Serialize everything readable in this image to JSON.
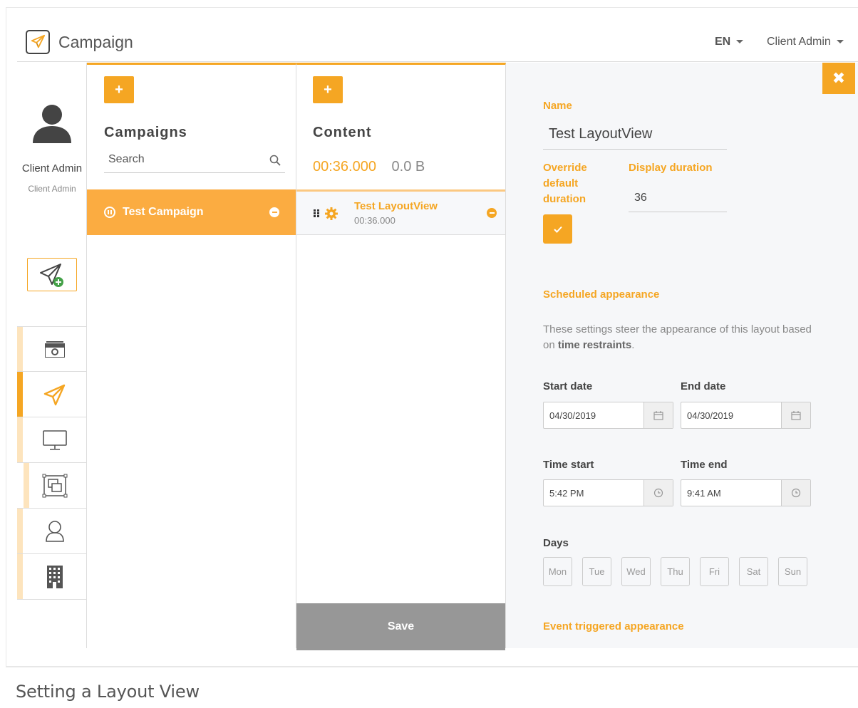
{
  "app": {
    "title": "Campaign"
  },
  "header": {
    "lang": "EN",
    "user_menu": "Client Admin"
  },
  "sidebar": {
    "user_name": "Client Admin",
    "user_role": "Client Admin",
    "nav": [
      {
        "name": "nav-media",
        "icon": "camera-icon"
      },
      {
        "name": "nav-campaigns",
        "icon": "paper-plane-icon",
        "active": true
      },
      {
        "name": "nav-screens",
        "icon": "monitor-icon"
      },
      {
        "name": "nav-layouts",
        "icon": "layout-icon"
      },
      {
        "name": "nav-users",
        "icon": "user-icon"
      },
      {
        "name": "nav-buildings",
        "icon": "building-icon"
      }
    ]
  },
  "campaigns": {
    "add_label": "+",
    "title": "Campaigns",
    "search_placeholder": "Search",
    "items": [
      {
        "name": "Test Campaign"
      }
    ]
  },
  "content": {
    "add_label": "+",
    "title": "Content",
    "duration": "00:36.000",
    "size": "0.0 B",
    "items": [
      {
        "title": "Test LayoutView",
        "duration": "00:36.000"
      }
    ],
    "save_label": "Save"
  },
  "detail": {
    "close_label": "✖",
    "name_label": "Name",
    "name_value": "Test LayoutView",
    "override_label_1": "Override",
    "override_label_2": "default",
    "override_label_3": "duration",
    "display_duration_label": "Display duration",
    "display_duration_value": "36",
    "scheduled_title": "Scheduled appearance",
    "scheduled_desc_1": "These settings steer the appearance of this layout based on ",
    "scheduled_desc_bold": "time restraints",
    "scheduled_desc_2": ".",
    "start_date_label": "Start date",
    "start_date_value": "04/30/2019",
    "end_date_label": "End date",
    "end_date_value": "04/30/2019",
    "time_start_label": "Time start",
    "time_start_value": "5:42 PM",
    "time_end_label": "Time end",
    "time_end_value": "9:41 AM",
    "days_label": "Days",
    "days": [
      "Mon",
      "Tue",
      "Wed",
      "Thu",
      "Fri",
      "Sat",
      "Sun"
    ],
    "event_title": "Event triggered appearance"
  },
  "caption": "Setting a Layout View",
  "colors": {
    "accent": "#f5a623",
    "accent_light": "#fde4bd",
    "save_gray": "#979797",
    "panel_bg": "#f6f7f9"
  }
}
